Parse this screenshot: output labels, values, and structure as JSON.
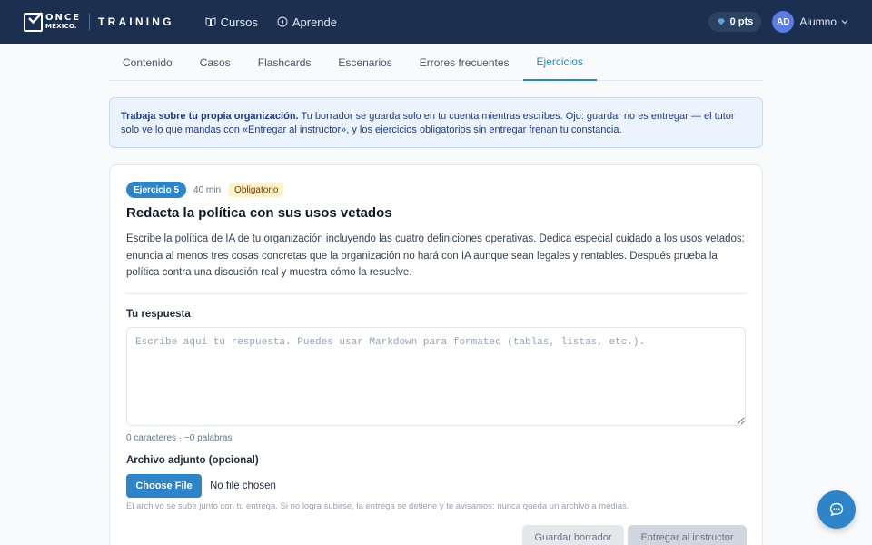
{
  "header": {
    "logo_once": "ONCE",
    "logo_mexico": "MÉXICO.",
    "logo_training": "TRAINING",
    "nav": [
      {
        "label": "Cursos",
        "icon": "book-icon"
      },
      {
        "label": "Aprende",
        "icon": "compass-icon"
      }
    ],
    "points": "0 pts",
    "avatar_initials": "AD",
    "user_name": "Alumno"
  },
  "tabs": [
    {
      "label": "Contenido",
      "active": false
    },
    {
      "label": "Casos",
      "active": false
    },
    {
      "label": "Flashcards",
      "active": false
    },
    {
      "label": "Escenarios",
      "active": false
    },
    {
      "label": "Errores frecuentes",
      "active": false
    },
    {
      "label": "Ejercicios",
      "active": true
    }
  ],
  "banner": {
    "bold": "Trabaja sobre tu propia organización.",
    "text": " Tu borrador se guarda solo en tu cuenta mientras escribes. Ojo: guardar no es entregar — el tutor solo ve lo que mandas con «Entregar al instructor», y los ejercicios obligatorios sin entregar frenan tu constancia."
  },
  "exercise": {
    "badge": "Ejercicio 5",
    "duration": "40 min",
    "required": "Obligatorio",
    "title": "Redacta la política con sus usos vetados",
    "description": "Escribe la política de IA de tu organización incluyendo las cuatro definiciones operativas. Dedica especial cuidado a los usos vetados: enuncia al menos tres cosas concretas que la organización no hará con IA aunque sean legales y rentables. Después prueba la política contra una discusión real y muestra cómo la resuelve.",
    "answer_label": "Tu respuesta",
    "answer_placeholder": "Escribe aquí tu respuesta. Puedes usar Markdown para formateo (tablas, listas, etc.).",
    "answer_value": "",
    "counter": "0 caracteres · ~0 palabras",
    "attach_label": "Archivo adjunto (opcional)",
    "file_button": "Choose File",
    "file_status": "No file chosen",
    "attach_hint": "El archivo se sube junto con tu entrega. Si no logra subirse, la entrega se detiene y te avisamos: nunca queda un archivo a medias.",
    "save_draft": "Guardar borrador",
    "submit": "Entregar al instructor"
  },
  "colors": {
    "header_bg": "#1b3050",
    "accent": "#2d84c8",
    "banner_bg": "#ebf4fe",
    "required_badge_bg": "#fef3c7"
  },
  "chat_fab": {
    "icon": "chat-icon"
  }
}
